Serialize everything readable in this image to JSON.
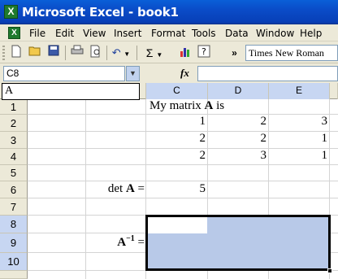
{
  "window": {
    "title": "Microsoft Excel - book1"
  },
  "menu": {
    "items": [
      "File",
      "Edit",
      "View",
      "Insert",
      "Format",
      "Tools",
      "Data",
      "Window",
      "Help"
    ]
  },
  "toolbar": {
    "font_name": "Times New Roman",
    "sigma": "Σ",
    "undo": "↶"
  },
  "formula_bar": {
    "name_box": "C8",
    "fx": "fx",
    "content": ""
  },
  "edit_line": "A",
  "columns": [
    "C",
    "D",
    "E"
  ],
  "rows": [
    "1",
    "2",
    "3",
    "4",
    "5",
    "6",
    "7",
    "8",
    "9",
    "10"
  ],
  "cells": {
    "c1": "My matrix A is",
    "matrix": [
      [
        "1",
        "2",
        "3"
      ],
      [
        "2",
        "2",
        "1"
      ],
      [
        "2",
        "3",
        "1"
      ]
    ],
    "det_label": "det A =",
    "det_value": "5",
    "inverse_label": "A",
    "inverse_sup": "−1",
    "inverse_eq": " ="
  }
}
